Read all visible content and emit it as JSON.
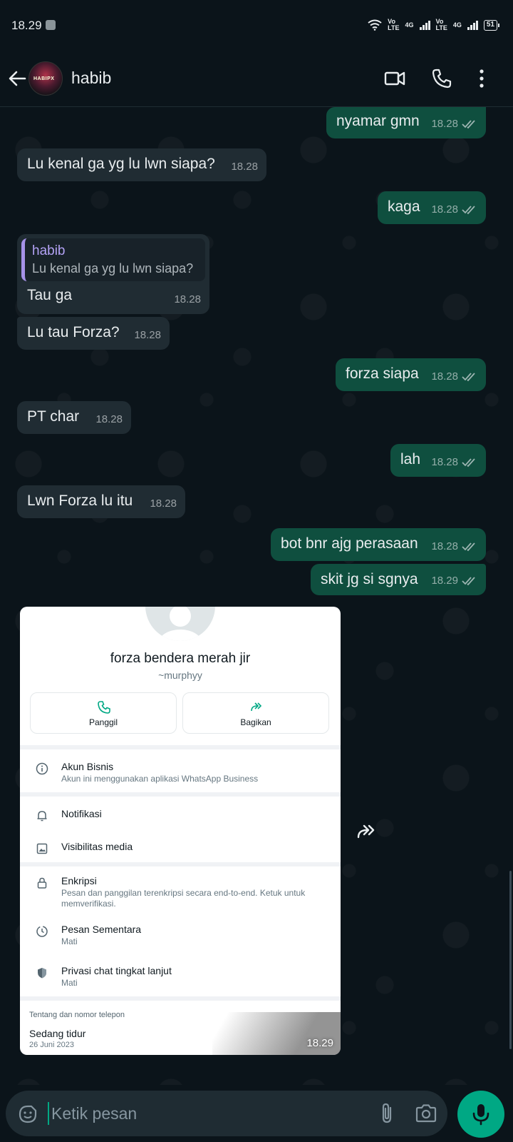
{
  "status_bar": {
    "time": "18.29",
    "net1_top": "Vo",
    "net1_bottom": "LTE",
    "net1_gen": "4G",
    "net2_top": "Vo",
    "net2_bottom": "LTE",
    "net2_gen": "4G",
    "battery": "51"
  },
  "header": {
    "contact_name": "habib",
    "avatar_text": "HABIPX"
  },
  "messages": [
    {
      "text": "nyamar gmn",
      "time": "18.28"
    },
    {
      "text": "Lu kenal ga yg lu lwn siapa?",
      "time": "18.28"
    },
    {
      "text": "kaga",
      "time": "18.28"
    },
    {
      "quote_name": "habib",
      "quote_text": "Lu kenal ga yg lu lwn siapa?",
      "text": "Tau ga",
      "time": "18.28"
    },
    {
      "text": "Lu tau Forza?",
      "time": "18.28"
    },
    {
      "text": "forza siapa",
      "time": "18.28"
    },
    {
      "text": "PT char",
      "time": "18.28"
    },
    {
      "text": "lah",
      "time": "18.28"
    },
    {
      "text": "Lwn Forza lu itu",
      "time": "18.28"
    },
    {
      "text": "bot bnr ajg perasaan",
      "time": "18.28"
    },
    {
      "text": "skit jg si sgnya",
      "time": "18.29"
    }
  ],
  "image_message": {
    "profile_name": "forza bendera merah jir",
    "username": "~murphyy",
    "call_label": "Panggil",
    "share_label": "Bagikan",
    "business_title": "Akun Bisnis",
    "business_sub": "Akun ini menggunakan aplikasi WhatsApp Business",
    "notif_title": "Notifikasi",
    "media_title": "Visibilitas media",
    "enc_title": "Enkripsi",
    "enc_sub": "Pesan dan panggilan terenkripsi secara end-to-end. Ketuk untuk memverifikasi.",
    "temp_title": "Pesan Sementara",
    "temp_sub": "Mati",
    "privacy_title": "Privasi chat tingkat lanjut",
    "privacy_sub": "Mati",
    "about_section": "Tentang dan nomor telepon",
    "about_status": "Sedang tidur",
    "about_date": "26 Juni 2023",
    "time": "18.29"
  },
  "input": {
    "placeholder": "Ketik pesan"
  },
  "colors": {
    "background": "#0b141a",
    "incoming_bubble": "#202c33",
    "outgoing_bubble": "#0f4f3f",
    "accent": "#00a884"
  }
}
